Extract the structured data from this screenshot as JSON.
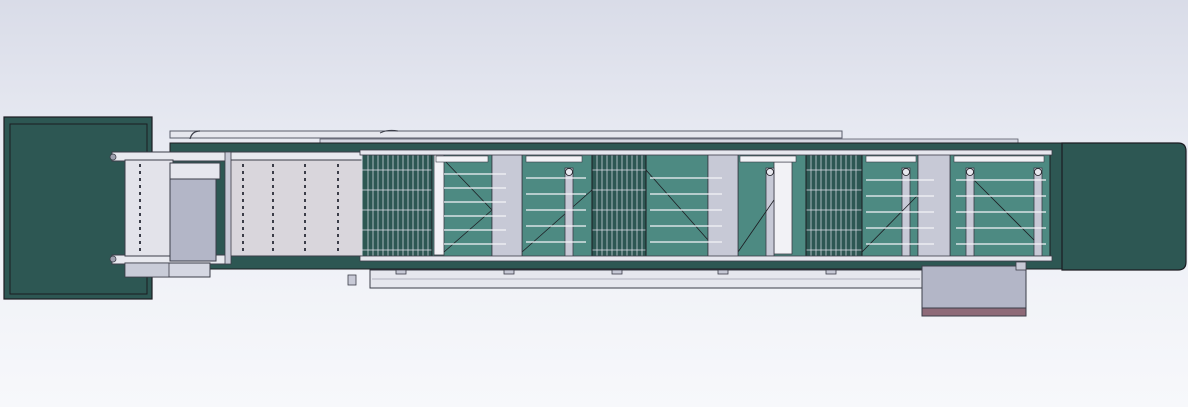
{
  "view": {
    "type": "cad-model-viewport",
    "projection": "top view",
    "visible_text": []
  },
  "colors": {
    "background_top": "#d9dce8",
    "background_bottom": "#f7f8fb",
    "housing_dark_green": "#2d5753",
    "chamber_teal": "#4d8a82",
    "frame_grey": "#c7c9d6",
    "belt_light": "#e3e3ea",
    "outline": "#1c1c22"
  },
  "model": {
    "units": [
      {
        "name": "feed-hopper",
        "shape": "dark-green box"
      },
      {
        "name": "infeed-conveyor",
        "rollers": 5
      },
      {
        "name": "drive-box",
        "shape": "grey box"
      },
      {
        "name": "tunnel-body",
        "chambers": 5,
        "wire-racks": 4
      },
      {
        "name": "discharge-housing",
        "shape": "dark-green rounded box"
      },
      {
        "name": "control-cabinet",
        "shape": "grey box"
      }
    ]
  }
}
